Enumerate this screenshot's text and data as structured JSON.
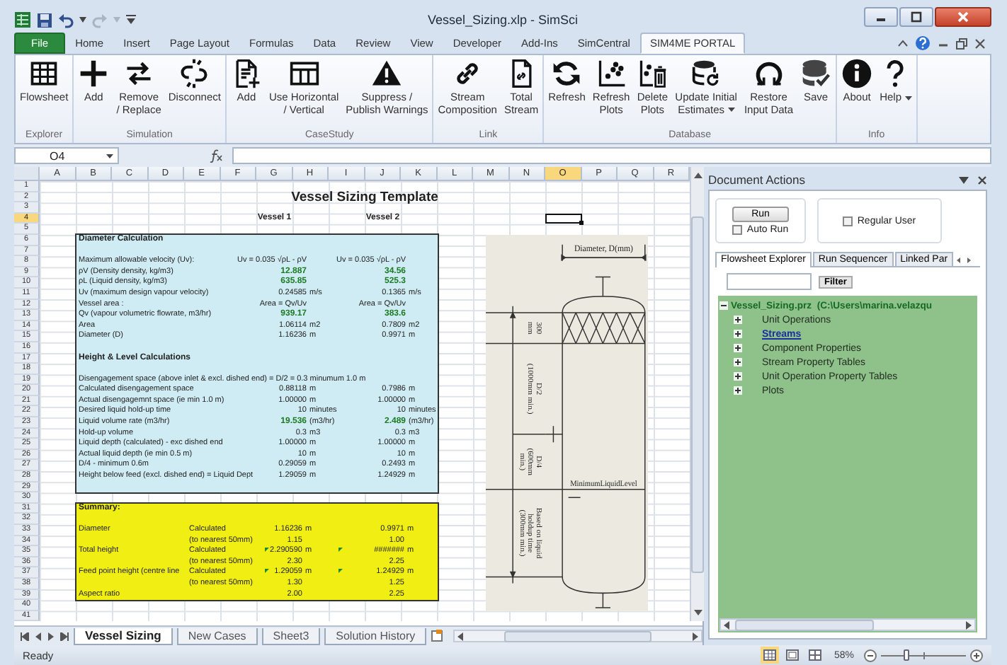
{
  "window": {
    "title": "Vessel_Sizing.xlp - SimSci"
  },
  "ribbon_tabs": [
    {
      "label": "File",
      "kind": "file",
      "selected": false
    },
    {
      "label": "Home",
      "kind": "tab",
      "selected": false
    },
    {
      "label": "Insert",
      "kind": "tab",
      "selected": false
    },
    {
      "label": "Page Layout",
      "kind": "tab",
      "selected": false
    },
    {
      "label": "Formulas",
      "kind": "tab",
      "selected": false
    },
    {
      "label": "Data",
      "kind": "tab",
      "selected": false
    },
    {
      "label": "Review",
      "kind": "tab",
      "selected": false
    },
    {
      "label": "View",
      "kind": "tab",
      "selected": false
    },
    {
      "label": "Developer",
      "kind": "tab",
      "selected": false
    },
    {
      "label": "Add-Ins",
      "kind": "tab",
      "selected": false
    },
    {
      "label": "SimCentral",
      "kind": "tab",
      "selected": false
    },
    {
      "label": "SIM4ME PORTAL",
      "kind": "tab",
      "selected": true
    }
  ],
  "ribbon_groups": [
    {
      "label": "Explorer",
      "buttons": [
        {
          "label": "Flowsheet",
          "dropdown": false
        }
      ]
    },
    {
      "label": "Simulation",
      "buttons": [
        {
          "label": "Add",
          "dropdown": false
        },
        {
          "label": "Remove\n/ Replace",
          "dropdown": false
        },
        {
          "label": "Disconnect",
          "dropdown": false
        }
      ]
    },
    {
      "label": "CaseStudy",
      "buttons": [
        {
          "label": "Add",
          "dropdown": false
        },
        {
          "label": "Use Horizontal\n/ Vertical",
          "dropdown": false
        },
        {
          "label": "Suppress /\nPublish Warnings",
          "dropdown": false
        }
      ]
    },
    {
      "label": "Link",
      "buttons": [
        {
          "label": "Stream\nComposition",
          "dropdown": false
        },
        {
          "label": "Total\nStream",
          "dropdown": false
        }
      ]
    },
    {
      "label": "Database",
      "buttons": [
        {
          "label": "Refresh",
          "dropdown": false
        },
        {
          "label": "Refresh\nPlots",
          "dropdown": false
        },
        {
          "label": "Delete\nPlots",
          "dropdown": false
        },
        {
          "label": "Update Initial\nEstimates",
          "dropdown": true
        },
        {
          "label": "Restore\nInput Data",
          "dropdown": false
        },
        {
          "label": "Save",
          "dropdown": false
        }
      ]
    },
    {
      "label": "Info",
      "buttons": [
        {
          "label": "About",
          "dropdown": false
        },
        {
          "label": "Help",
          "dropdown": true
        }
      ]
    }
  ],
  "formula_bar": {
    "name_box": "O4"
  },
  "sheet": {
    "columns": [
      {
        "label": "A",
        "selected": false
      },
      {
        "label": "B",
        "selected": false
      },
      {
        "label": "C",
        "selected": false
      },
      {
        "label": "D",
        "selected": false
      },
      {
        "label": "E",
        "selected": false
      },
      {
        "label": "F",
        "selected": false
      },
      {
        "label": "G",
        "selected": false
      },
      {
        "label": "H",
        "selected": false
      },
      {
        "label": "I",
        "selected": false
      },
      {
        "label": "J",
        "selected": false
      },
      {
        "label": "K",
        "selected": false
      },
      {
        "label": "L",
        "selected": false
      },
      {
        "label": "M",
        "selected": false
      },
      {
        "label": "N",
        "selected": false
      },
      {
        "label": "O",
        "selected": true
      },
      {
        "label": "P",
        "selected": false
      },
      {
        "label": "Q",
        "selected": false
      },
      {
        "label": "R",
        "selected": false
      }
    ],
    "rows": [
      {
        "label": "1",
        "selected": false
      },
      {
        "label": "2",
        "selected": false
      },
      {
        "label": "3",
        "selected": false
      },
      {
        "label": "4",
        "selected": true
      },
      {
        "label": "5",
        "selected": false
      },
      {
        "label": "6",
        "selected": false
      },
      {
        "label": "7",
        "selected": false
      },
      {
        "label": "8",
        "selected": false
      },
      {
        "label": "9",
        "selected": false
      },
      {
        "label": "10",
        "selected": false
      },
      {
        "label": "11",
        "selected": false
      },
      {
        "label": "12",
        "selected": false
      },
      {
        "label": "13",
        "selected": false
      },
      {
        "label": "14",
        "selected": false
      },
      {
        "label": "15",
        "selected": false
      },
      {
        "label": "16",
        "selected": false
      },
      {
        "label": "17",
        "selected": false
      },
      {
        "label": "18",
        "selected": false
      },
      {
        "label": "19",
        "selected": false
      },
      {
        "label": "20",
        "selected": false
      },
      {
        "label": "21",
        "selected": false
      },
      {
        "label": "22",
        "selected": false
      },
      {
        "label": "23",
        "selected": false
      },
      {
        "label": "24",
        "selected": false
      },
      {
        "label": "25",
        "selected": false
      },
      {
        "label": "26",
        "selected": false
      },
      {
        "label": "27",
        "selected": false
      },
      {
        "label": "28",
        "selected": false
      },
      {
        "label": "29",
        "selected": false
      },
      {
        "label": "30",
        "selected": false
      },
      {
        "label": "31",
        "selected": false
      },
      {
        "label": "32",
        "selected": false
      },
      {
        "label": "33",
        "selected": false
      },
      {
        "label": "34",
        "selected": false
      },
      {
        "label": "35",
        "selected": false
      },
      {
        "label": "36",
        "selected": false
      },
      {
        "label": "37",
        "selected": false
      },
      {
        "label": "38",
        "selected": false
      },
      {
        "label": "39",
        "selected": false
      },
      {
        "label": "40",
        "selected": false
      },
      {
        "label": "41",
        "selected": false
      }
    ],
    "title": "Vessel Sizing Template",
    "headers": [
      "Vessel 1",
      "Vessel 2"
    ]
  },
  "calc_panel": {
    "rows": [
      {
        "kind": "heading",
        "label": "Diameter Calculation"
      },
      {
        "kind": "blank"
      },
      {
        "kind": "data",
        "label": "Maximum allowable velocity (Uv):",
        "v1": "Uv = 0.035 √ρL - ρV",
        "v2": "Uv = 0.035 √ρL - ρV"
      },
      {
        "kind": "input",
        "label": "ρV (Density density, kg/m3)",
        "v1": "12.887",
        "v2": "34.56"
      },
      {
        "kind": "input",
        "label": "ρL (Liquid density, kg/m3)",
        "v1": "635.85",
        "v2": "525.3"
      },
      {
        "kind": "data",
        "label": "Uv (maximum design vapour velocity)",
        "v1": "0.24585",
        "u1": "m/s",
        "v2": "0.1365",
        "u2": "m/s"
      },
      {
        "kind": "data",
        "label": "Vessel area :",
        "v1": "Area = Qv/Uv",
        "v2": "Area = Qv/Uv"
      },
      {
        "kind": "input",
        "label": "Qv (vapour volumetric flowrate, m3/hr)",
        "v1": "939.17",
        "v2": "383.6"
      },
      {
        "kind": "data",
        "label": "Area",
        "v1": "1.06114",
        "u1": "m2",
        "v2": "0.7809",
        "u2": "m2"
      },
      {
        "kind": "data",
        "label": "Diameter (D)",
        "v1": "1.16236",
        "u1": "m",
        "v2": "0.9971",
        "u2": "m"
      },
      {
        "kind": "blank"
      },
      {
        "kind": "heading",
        "label": "Height & Level Calculations"
      },
      {
        "kind": "blank"
      },
      {
        "kind": "note",
        "label": "Disengagement space (above inlet & excl. dished end) = D/2 = 0.3 minumum 1.0 m"
      },
      {
        "kind": "data",
        "label": "Calculated disengagement space",
        "v1": "0.88118",
        "u1": "m",
        "v2": "0.7986",
        "u2": "m"
      },
      {
        "kind": "data",
        "label": "Actual disengagemnt space (ie min 1.0 m)",
        "v1": "1.00000",
        "u1": "m",
        "v2": "1.00000",
        "u2": "m"
      },
      {
        "kind": "data",
        "label": "Desired liquid hold-up time",
        "v1": "10",
        "u1": "minutes",
        "v2": "10",
        "u2": "minutes"
      },
      {
        "kind": "input",
        "label": "Liquid volume rate (m3/hr)",
        "v1": "19.536",
        "u1": "(m3/hr)",
        "v2": "2.489",
        "u2": "(m3/hr)"
      },
      {
        "kind": "data",
        "label": "Hold-up volume",
        "v1": "0.3",
        "u1": "m3",
        "v2": "0.3",
        "u2": "m3"
      },
      {
        "kind": "data",
        "label": "Liquid depth (calculated) - exc dished end",
        "v1": "1.00000",
        "u1": "m",
        "v2": "1.00000",
        "u2": "m"
      },
      {
        "kind": "data",
        "label": "Actual liquid depth (ie min 0.5 m)",
        "v1": "10",
        "u1": "m",
        "v2": "10",
        "u2": "m"
      },
      {
        "kind": "data",
        "label": "D/4 - minimum 0.6m",
        "v1": "0.29059",
        "u1": "m",
        "v2": "0.2493",
        "u2": "m"
      },
      {
        "kind": "data",
        "label": "Height below feed (excl. dished end) = Liquid Dept",
        "v1": "1.29059",
        "u1": "m",
        "v2": "1.24929",
        "u2": "m"
      },
      {
        "kind": "blank"
      }
    ]
  },
  "summary_panel": {
    "rows": [
      {
        "kind": "heading",
        "label": "Summary:"
      },
      {
        "kind": "blank"
      },
      {
        "kind": "data",
        "label": "Diameter",
        "sub": "Calculated",
        "v1": "1.16236",
        "u1": "m",
        "v2": "0.9971",
        "u2": "m",
        "flag": false
      },
      {
        "kind": "data",
        "sub": "(to nearest 50mm)",
        "v1": "1.15",
        "v2": "1.00",
        "flag": false
      },
      {
        "kind": "data",
        "label": "Total height",
        "sub": "Calculated",
        "v1": "2.290590",
        "u1": "m",
        "v2": "#######",
        "u2": "m",
        "flag": true
      },
      {
        "kind": "data",
        "sub": "(to nearest 50mm)",
        "v1": "2.30",
        "v2": "2.25",
        "flag": false
      },
      {
        "kind": "data",
        "label": "Feed point height (centre line",
        "sub": "Calculated",
        "v1": "1.29059",
        "u1": "m",
        "v2": "1.24929",
        "u2": "m",
        "flag": true
      },
      {
        "kind": "data",
        "sub": "(to nearest 50mm)",
        "v1": "1.30",
        "v2": "1.25",
        "flag": false
      },
      {
        "kind": "data",
        "label": "Aspect ratio",
        "v1": "2.00",
        "v2": "2.25",
        "flag": false
      }
    ]
  },
  "vessel_drawing": {
    "diameter_label": "Diameter, D(mm)",
    "level_label": "MinimumLiquidLevel",
    "section_labels": [
      [
        "300",
        "mm"
      ],
      [
        "D/2",
        "(1000mm min.)"
      ],
      [
        "D/4",
        "(600mm",
        "min.)"
      ],
      [
        "Based on liquid",
        "holdup time",
        "(300mm min.)"
      ]
    ]
  },
  "sheet_tabs": [
    {
      "label": "Vessel Sizing",
      "selected": true
    },
    {
      "label": "New Cases",
      "selected": false
    },
    {
      "label": "Sheet3",
      "selected": false
    },
    {
      "label": "Solution History",
      "selected": false
    }
  ],
  "document_actions": {
    "title": "Document Actions",
    "run_button": "Run",
    "auto_run": {
      "label": "Auto Run",
      "checked": false
    },
    "regular_user": {
      "label": "Regular User",
      "checked": false
    },
    "tabs": [
      {
        "label": "Flowsheet Explorer",
        "selected": true
      },
      {
        "label": "Run Sequencer",
        "selected": false
      },
      {
        "label": "Linked Par",
        "selected": false
      }
    ],
    "filter_button": "Filter",
    "tree": {
      "label": "Vessel_Sizing.prz  (C:\\Users\\marina.velazqu",
      "expanded": true,
      "children": [
        {
          "label": "Unit Operations",
          "expanded": false,
          "selected": false
        },
        {
          "label": "Streams",
          "expanded": false,
          "selected": true
        },
        {
          "label": "Component Properties",
          "expanded": false,
          "selected": false
        },
        {
          "label": "Stream Property Tables",
          "expanded": false,
          "selected": false
        },
        {
          "label": "Unit Operation Property Tables",
          "expanded": false,
          "selected": false
        },
        {
          "label": "Plots",
          "expanded": false,
          "selected": false
        }
      ]
    }
  },
  "status_bar": {
    "status": "Ready",
    "views": [
      {
        "selected": true
      },
      {
        "selected": false
      },
      {
        "selected": false
      }
    ],
    "zoom": "58%",
    "zoom_slider": {
      "level": 0.3
    }
  }
}
